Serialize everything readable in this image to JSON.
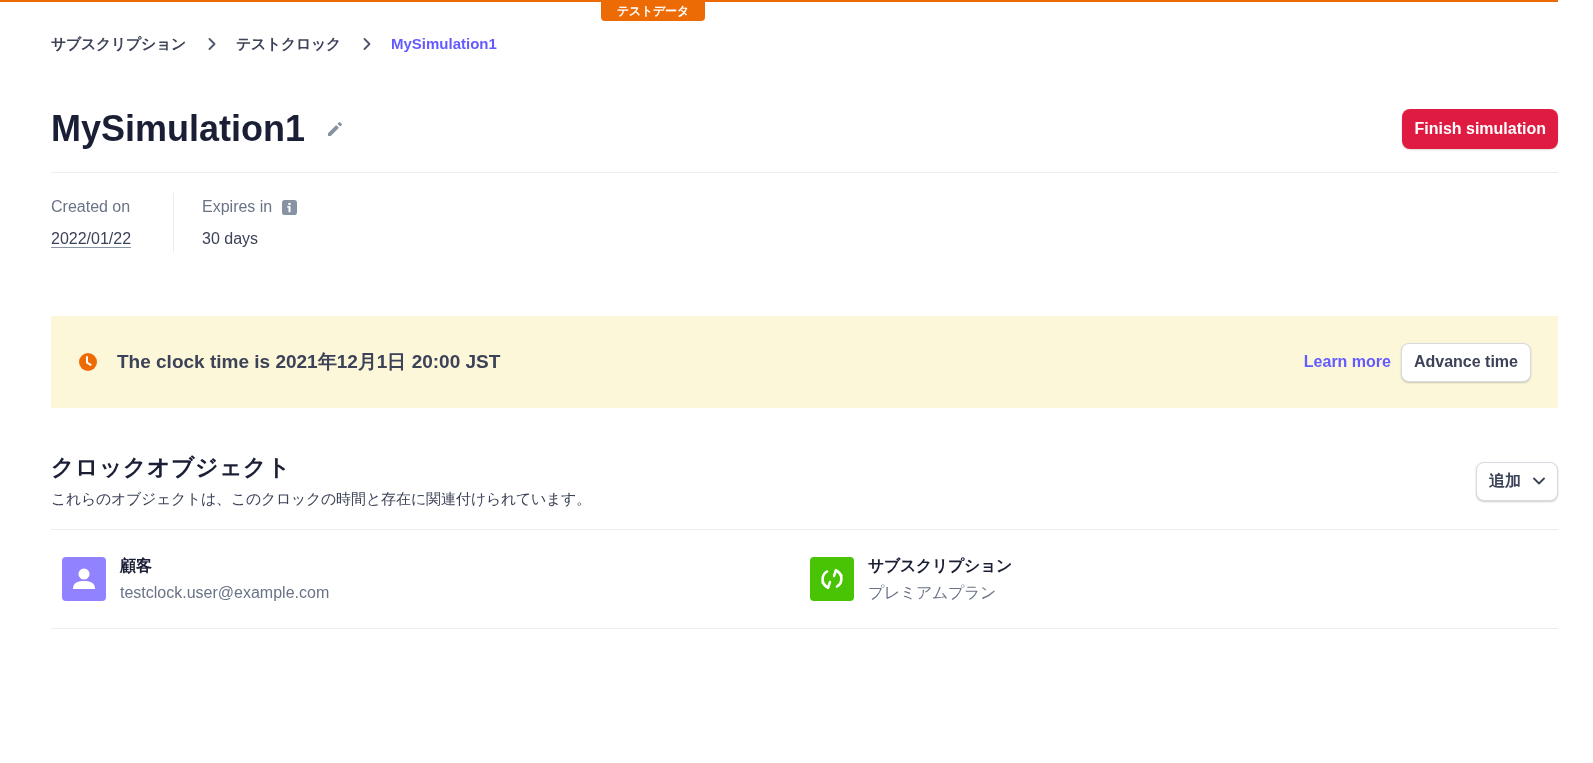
{
  "test_badge": "テストデータ",
  "breadcrumb": [
    {
      "label": "サブスクリプション",
      "current": false
    },
    {
      "label": "テストクロック",
      "current": false
    },
    {
      "label": "MySimulation1",
      "current": true
    }
  ],
  "title": "MySimulation1",
  "finish_button": "Finish simulation",
  "details": [
    {
      "kind": "date",
      "label": "Created on",
      "value": "2022/01/22"
    },
    {
      "kind": "duration",
      "label": "Expires in",
      "value": "30 days"
    }
  ],
  "banner": {
    "text": "The clock time is 2021年12月1日 20:00 JST",
    "link": "Learn more",
    "button": "Advance time"
  },
  "section": {
    "title": "クロックオブジェクト",
    "description": "これらのオブジェクトは、このクロックの時間と存在に関連付けられています。",
    "add_button": "追加",
    "objects": [
      {
        "kind": "customer",
        "title": "顧客",
        "subtitle": "testclock.user@example.com",
        "color": "#9182ff"
      },
      {
        "kind": "subscription",
        "title": "サブスクリプション",
        "subtitle": "プレミアムプラン",
        "color": "#48c404"
      }
    ]
  }
}
